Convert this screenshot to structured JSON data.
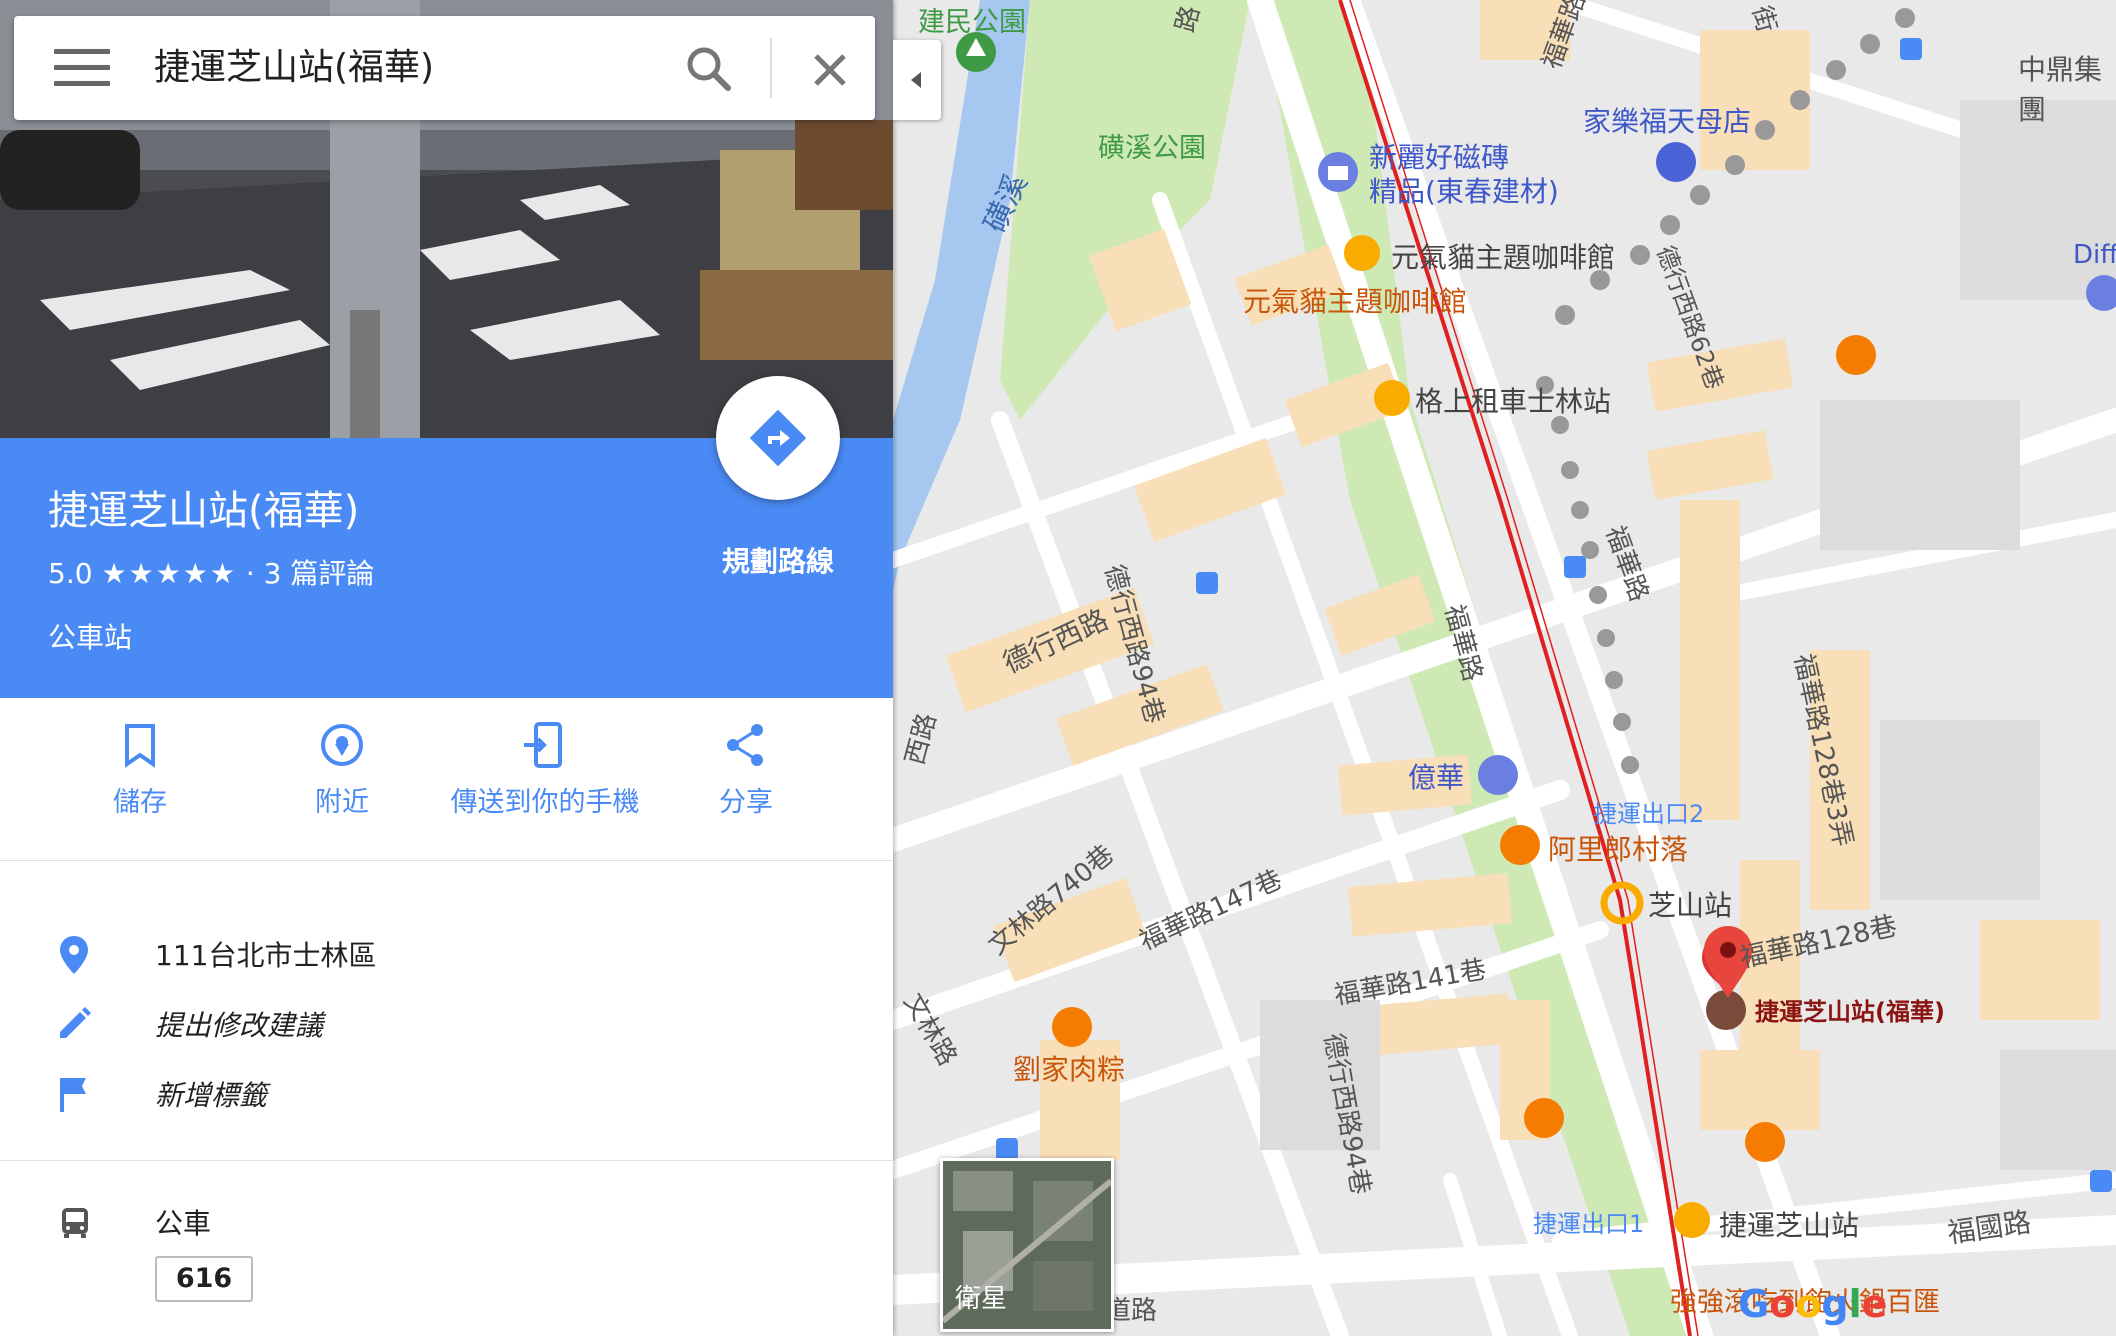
{
  "search": {
    "query": "捷運芝山站(福華)"
  },
  "place": {
    "name": "捷運芝山站(福華)",
    "rating": "5.0",
    "stars": "★★★★★",
    "reviews": "· 3 篇評論",
    "category": "公車站",
    "directions_label": "規劃路線"
  },
  "actions": [
    {
      "label": "儲存",
      "icon": "bookmark-icon"
    },
    {
      "label": "附近",
      "icon": "nearby-icon"
    },
    {
      "label": "傳送到你的手機",
      "icon": "send-to-phone-icon"
    },
    {
      "label": "分享",
      "icon": "share-icon"
    }
  ],
  "info": {
    "address": "111台北市士林區",
    "suggest_edit": "提出修改建議",
    "add_label": "新增標籤"
  },
  "transit": {
    "type": "公車",
    "route": "616"
  },
  "map": {
    "satellite_label": "衛星",
    "logo": "Google",
    "labels": [
      {
        "id": "park1",
        "text": "建民公園"
      },
      {
        "id": "park2",
        "text": "磺溪公園"
      },
      {
        "id": "river",
        "text": "磺溪"
      },
      {
        "id": "store1",
        "text": "家樂福天母店"
      },
      {
        "id": "zhongding",
        "text": "中鼎集團"
      },
      {
        "id": "tile",
        "text": "新麗好磁磚"
      },
      {
        "id": "tile2",
        "text": "精品(東春建材)"
      },
      {
        "id": "cafe1",
        "text": "元氣貓主題咖啡館"
      },
      {
        "id": "cafe2",
        "text": "元氣貓主題咖啡館"
      },
      {
        "id": "rent",
        "text": "格上租車士林站"
      },
      {
        "id": "dexingw",
        "text": "德行西路"
      },
      {
        "id": "dexingw94",
        "text": "德行西路94巷"
      },
      {
        "id": "dexingw94b",
        "text": "德行西路94巷"
      },
      {
        "id": "fuhua1",
        "text": "福華路"
      },
      {
        "id": "fuhua2",
        "text": "福華路"
      },
      {
        "id": "fuhua3",
        "text": "福華路"
      },
      {
        "id": "fuhua128_3",
        "text": "福華路128巷3弄"
      },
      {
        "id": "fuhua128",
        "text": "福華路128巷"
      },
      {
        "id": "fuhua147",
        "text": "福華路147巷"
      },
      {
        "id": "fuhua141",
        "text": "福華路141巷"
      },
      {
        "id": "yihua",
        "text": "億華"
      },
      {
        "id": "exit2",
        "text": "捷運出口2"
      },
      {
        "id": "alilang",
        "text": "阿里郎村落"
      },
      {
        "id": "zhishan",
        "text": "芝山站"
      },
      {
        "id": "busstop",
        "text": "捷運芝山站(福華)"
      },
      {
        "id": "wenlin740",
        "text": "文林路740巷"
      },
      {
        "id": "liu",
        "text": "劉家肉粽"
      },
      {
        "id": "wenlin",
        "text": "文林路"
      },
      {
        "id": "exit1",
        "text": "捷運出口1"
      },
      {
        "id": "zhishan2",
        "text": "捷運芝山站"
      },
      {
        "id": "fuguo",
        "text": "福國路"
      },
      {
        "id": "hotpot",
        "text": "強強滾吃到飽火鍋百匯"
      },
      {
        "id": "dexing62",
        "text": "德行西路62巷"
      },
      {
        "id": "road1",
        "text": "西路"
      },
      {
        "id": "road2",
        "text": "路"
      },
      {
        "id": "road3",
        "text": "街"
      },
      {
        "id": "diff",
        "text": "Diff"
      },
      {
        "id": "dao",
        "text": "道路"
      }
    ]
  },
  "colors": {
    "accent": "#4a8af4",
    "pin": "#d33",
    "poi_orange": "#f57c00",
    "poi_gold": "#f9ab00"
  }
}
